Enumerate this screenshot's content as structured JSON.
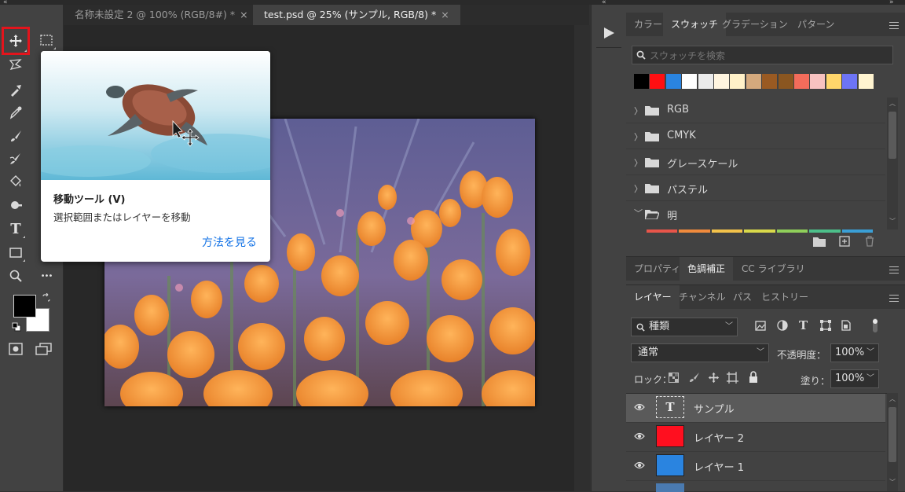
{
  "window": {
    "collapse_left": "«",
    "collapse_mid": "«",
    "collapse_right": "»"
  },
  "tabs": [
    {
      "label": "名称未設定 2 @ 100% (RGB/8#) *",
      "close": "×"
    },
    {
      "label": "test.psd @ 25% (サンプル, RGB/8) *",
      "close": "×"
    }
  ],
  "toolbar": {
    "tools": [
      "move-icon",
      "marquee-icon",
      "lasso-icon",
      "quick-select-icon",
      "crop-icon",
      "eyedropper-icon",
      "brush-icon",
      "stamp-icon",
      "paint-bucket-icon",
      "dodge-icon",
      "text-icon",
      "rectangle-icon",
      "zoom-icon",
      "more-icon"
    ],
    "text_tool_label": "T",
    "more_label": "•••",
    "foreground_color": "#000000",
    "background_color": "#ffffff"
  },
  "tooltip": {
    "title": "移動ツール (V)",
    "description": "選択範囲またはレイヤーを移動",
    "link": "方法を見る"
  },
  "swatches_panel": {
    "tabs": [
      "カラー",
      "スウォッチ",
      "グラデーション",
      "パターン"
    ],
    "active_tab": 1,
    "search_placeholder": "スウォッチを検索",
    "colors": [
      "#000000",
      "#ff0f12",
      "#2a84e0",
      "#ffffff",
      "#ebebeb",
      "#fff5e0",
      "#fff1c8",
      "#d4a97d",
      "#9a5a22",
      "#8a5620",
      "#f36c5b",
      "#f7c2c0",
      "#ffd66b",
      "#6d74f5",
      "#fff4d0"
    ],
    "groups": [
      {
        "name": "RGB",
        "expanded": false
      },
      {
        "name": "CMYK",
        "expanded": false
      },
      {
        "name": "グレースケール",
        "expanded": false
      },
      {
        "name": "パステル",
        "expanded": false
      },
      {
        "name": "明",
        "expanded": true
      }
    ],
    "bright_colors": [
      "#e8554a",
      "#f08a3c",
      "#f3c24a",
      "#d9d94a",
      "#8fcf5a",
      "#4cbf8a",
      "#3a9fd6"
    ]
  },
  "adjust_panel": {
    "tabs": [
      "プロパティ",
      "色調補正",
      "CC ライブラリ"
    ],
    "active_tab": 1
  },
  "layers_panel": {
    "tabs": [
      "レイヤー",
      "チャンネル",
      "パス",
      "ヒストリー"
    ],
    "active_tab": 0,
    "filter_label": "種類",
    "blend_mode": "通常",
    "opacity_label": "不透明度：",
    "opacity_value": "100%",
    "lock_label": "ロック：",
    "fill_label": "塗り：",
    "fill_value": "100%",
    "layers": [
      {
        "name": "サンプル",
        "type": "text",
        "thumb_label": "T",
        "selected": true
      },
      {
        "name": "レイヤー 2",
        "type": "fill",
        "color": "#ff0f1f",
        "selected": false
      },
      {
        "name": "レイヤー 1",
        "type": "fill",
        "color": "#2a84e0",
        "selected": false
      }
    ]
  },
  "colors": {
    "accent_link": "#1473e6",
    "highlight_border": "#e3141c"
  }
}
